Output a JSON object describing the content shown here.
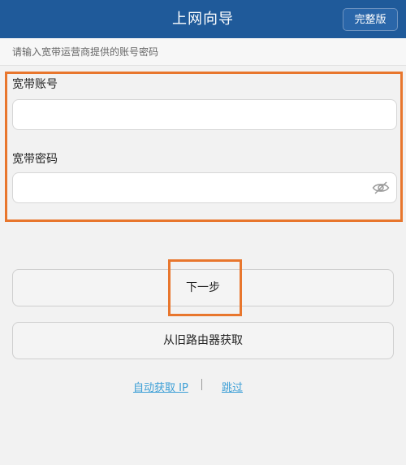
{
  "header": {
    "title": "上网向导",
    "full_version_label": "完整版"
  },
  "hint": "请输入宽带运营商提供的账号密码",
  "form": {
    "account_label": "宽带账号",
    "account_value": "",
    "password_label": "宽带密码",
    "password_value": ""
  },
  "buttons": {
    "next_label": "下一步",
    "fetch_from_old_router_label": "从旧路由器获取"
  },
  "links": {
    "auto_ip": "自动获取 IP",
    "skip": "跳过"
  },
  "colors": {
    "header_bg": "#1f5a9a",
    "highlight": "#e8762d",
    "link": "#3c9fd6"
  },
  "icons": {
    "password_visibility": "eye-off-icon"
  }
}
